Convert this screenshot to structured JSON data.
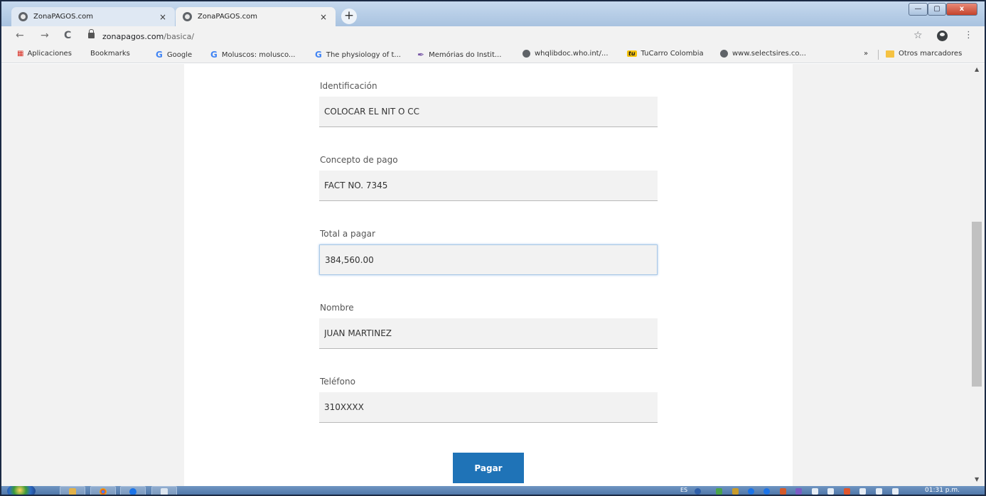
{
  "browser": {
    "tabs": [
      {
        "title": "ZonaPAGOS.com",
        "active": false
      },
      {
        "title": "ZonaPAGOS.com",
        "active": true
      }
    ],
    "tab_close_glyph": "×",
    "new_tab_glyph": "+",
    "window_controls": {
      "minimize": "—",
      "maximize": "▢",
      "close": "x"
    },
    "nav": {
      "back": "←",
      "forward": "→",
      "reload": "C"
    },
    "url": {
      "domain": "zonapagos.com",
      "path": "/basica/"
    },
    "bookmark_star": "☆",
    "menu_glyph": "⋮",
    "bookmarks": [
      {
        "label": "Aplicaciones",
        "icon": "apps-grid-icon"
      },
      {
        "label": "Bookmarks",
        "icon": "star-icon"
      },
      {
        "label": "Google",
        "icon": "google-icon"
      },
      {
        "label": "Moluscos: molusco...",
        "icon": "google-icon"
      },
      {
        "label": "The physiology of t...",
        "icon": "google-icon"
      },
      {
        "label": "Memórias do Instit...",
        "icon": "feather-icon"
      },
      {
        "label": "whqlibdoc.who.int/...",
        "icon": "globe-icon"
      },
      {
        "label": "TuCarro Colombia",
        "icon": "tucarro-icon"
      },
      {
        "label": "www.selectsires.co...",
        "icon": "globe-icon"
      }
    ],
    "bookmarks_overflow": "»",
    "other_bookmarks": "Otros marcadores"
  },
  "form": {
    "fields": [
      {
        "label": "Identificación",
        "value": "COLOCAR EL NIT O CC",
        "focused": false
      },
      {
        "label": "Concepto de pago",
        "value": "FACT NO. 7345",
        "focused": false
      },
      {
        "label": "Total a pagar",
        "value": "384,560.00",
        "focused": true
      },
      {
        "label": "Nombre",
        "value": "JUAN MARTINEZ",
        "focused": false
      },
      {
        "label": "Teléfono",
        "value": "310XXXX",
        "focused": false
      }
    ],
    "submit_label": "Pagar",
    "submit_color": "#1f73b7"
  },
  "taskbar": {
    "language": "ES",
    "clock": "01:31 p.m."
  }
}
